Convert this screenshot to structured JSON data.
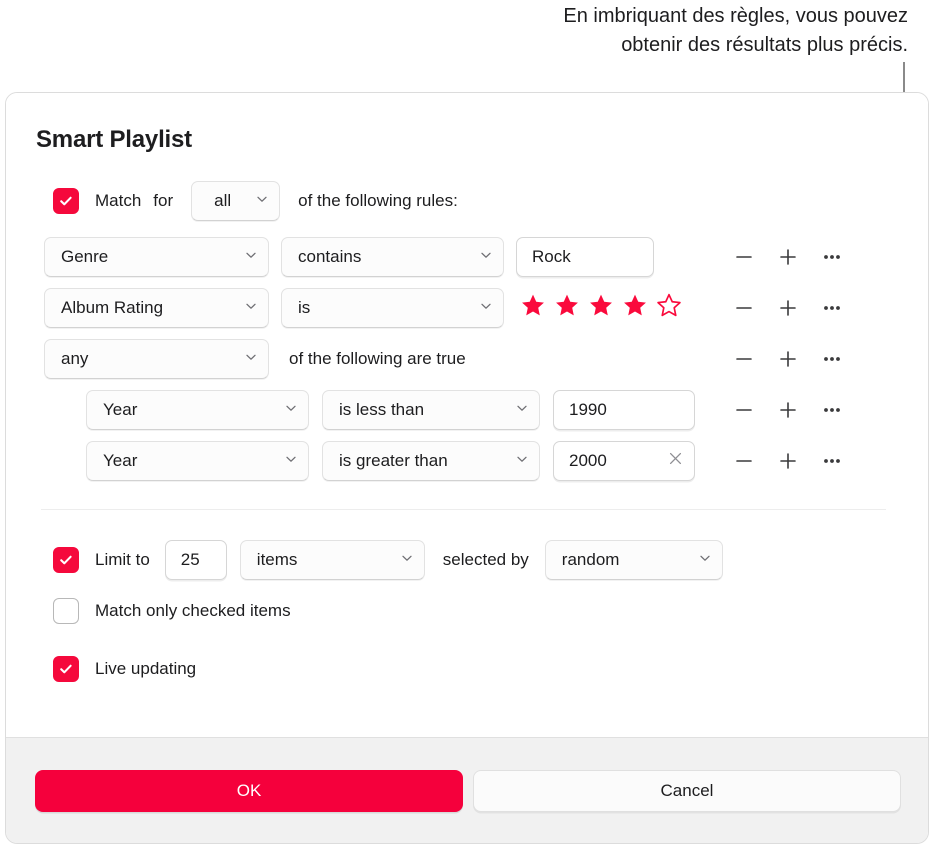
{
  "callout": {
    "line1": "En imbriquant des règles, vous pouvez",
    "line2": "obtenir des résultats plus précis."
  },
  "dialog": {
    "title": "Smart Playlist",
    "match": {
      "checked": true,
      "label_match": "Match",
      "label_for": "for",
      "scope_value": "all",
      "label_tail": "of the following rules:"
    },
    "rules": [
      {
        "field": "Genre",
        "operator": "contains",
        "value": "Rock",
        "value_type": "text"
      },
      {
        "field": "Album Rating",
        "operator": "is",
        "value_type": "stars",
        "stars_filled": 4,
        "stars_total": 5
      },
      {
        "field": "any",
        "value_type": "group",
        "group_label": "of the following are true"
      },
      {
        "field": "Year",
        "operator": "is less than",
        "value": "1990",
        "value_type": "text",
        "nested": true,
        "clearable": false
      },
      {
        "field": "Year",
        "operator": "is greater than",
        "value": "2000",
        "value_type": "text",
        "nested": true,
        "clearable": true
      }
    ],
    "row_actions": {
      "remove": "minus-icon",
      "add": "plus-icon",
      "more": "ellipsis-icon"
    },
    "options": {
      "limit": {
        "checked": true,
        "label": "Limit to",
        "amount": "25",
        "unit": "items",
        "selected_by_label": "selected by",
        "selected_by": "random"
      },
      "match_only_checked": {
        "checked": false,
        "label": "Match only checked items"
      },
      "live_updating": {
        "checked": true,
        "label": "Live updating"
      }
    },
    "footer": {
      "ok_label": "OK",
      "cancel_label": "Cancel"
    }
  },
  "colors": {
    "accent_red": "#F5093C",
    "ok_button": "#F5003C",
    "star_red": "#FA0A3C",
    "callout_gray": "#8A8A8A"
  }
}
